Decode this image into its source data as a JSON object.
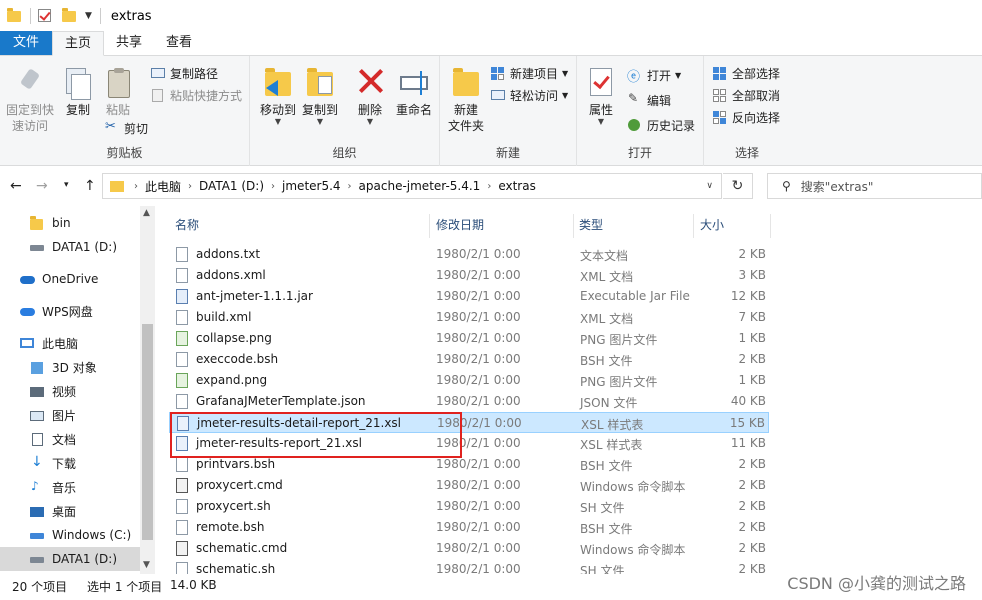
{
  "window": {
    "title": "extras"
  },
  "ribbon_tabs": [
    "文件",
    "主页",
    "共享",
    "查看"
  ],
  "ribbon": {
    "clipboard": {
      "label": "剪贴板",
      "pin": "固定到快速访问",
      "pin_line1": "固定到快",
      "pin_line2": "速访问",
      "copy": "复制",
      "paste": "粘贴",
      "copy_path": "复制路径",
      "paste_shortcut": "粘贴快捷方式",
      "cut": "剪切"
    },
    "organize": {
      "label": "组织",
      "move_to": "移动到",
      "copy_to": "复制到",
      "delete": "删除",
      "rename": "重命名"
    },
    "new": {
      "label": "新建",
      "new_folder_line1": "新建",
      "new_folder_line2": "文件夹",
      "new_item": "新建项目",
      "easy_access": "轻松访问"
    },
    "open": {
      "label": "打开",
      "properties": "属性",
      "open": "打开",
      "edit": "编辑",
      "history": "历史记录"
    },
    "select": {
      "label": "选择",
      "select_all": "全部选择",
      "select_none": "全部取消",
      "invert": "反向选择"
    }
  },
  "address": {
    "crumbs": [
      "此电脑",
      "DATA1 (D:)",
      "jmeter5.4",
      "apache-jmeter-5.4.1",
      "extras"
    ],
    "search_placeholder": "搜索\"extras\""
  },
  "nav_pane": {
    "items": [
      {
        "label": "bin",
        "icon": "folder-icon"
      },
      {
        "label": "DATA1 (D:)",
        "icon": "drive-icon"
      },
      {
        "label": "OneDrive",
        "icon": "cloud-icon"
      },
      {
        "label": "WPS网盘",
        "icon": "cloud-icon"
      },
      {
        "label": "此电脑",
        "icon": "computer-icon"
      },
      {
        "label": "3D 对象",
        "icon": "cube-icon"
      },
      {
        "label": "视频",
        "icon": "video-icon"
      },
      {
        "label": "图片",
        "icon": "picture-icon"
      },
      {
        "label": "文档",
        "icon": "document-icon"
      },
      {
        "label": "下载",
        "icon": "download-icon"
      },
      {
        "label": "音乐",
        "icon": "music-icon"
      },
      {
        "label": "桌面",
        "icon": "desktop-icon"
      },
      {
        "label": "Windows (C:)",
        "icon": "drive-icon"
      },
      {
        "label": "DATA1 (D:)",
        "icon": "drive-icon"
      }
    ]
  },
  "columns": {
    "name": "名称",
    "date": "修改日期",
    "type": "类型",
    "size": "大小"
  },
  "files": [
    {
      "name": "addons.txt",
      "date": "1980/2/1 0:00",
      "type": "文本文档",
      "size": "2 KB",
      "icon": "txt"
    },
    {
      "name": "addons.xml",
      "date": "1980/2/1 0:00",
      "type": "XML 文档",
      "size": "3 KB",
      "icon": "txt"
    },
    {
      "name": "ant-jmeter-1.1.1.jar",
      "date": "1980/2/1 0:00",
      "type": "Executable Jar File",
      "size": "12 KB",
      "icon": "jar"
    },
    {
      "name": "build.xml",
      "date": "1980/2/1 0:00",
      "type": "XML 文档",
      "size": "7 KB",
      "icon": "txt"
    },
    {
      "name": "collapse.png",
      "date": "1980/2/1 0:00",
      "type": "PNG 图片文件",
      "size": "1 KB",
      "icon": "png"
    },
    {
      "name": "execcode.bsh",
      "date": "1980/2/1 0:00",
      "type": "BSH 文件",
      "size": "2 KB",
      "icon": "txt"
    },
    {
      "name": "expand.png",
      "date": "1980/2/1 0:00",
      "type": "PNG 图片文件",
      "size": "1 KB",
      "icon": "png"
    },
    {
      "name": "GrafanaJMeterTemplate.json",
      "date": "1980/2/1 0:00",
      "type": "JSON 文件",
      "size": "40 KB",
      "icon": "txt"
    },
    {
      "name": "jmeter-results-detail-report_21.xsl",
      "date": "1980/2/1 0:00",
      "type": "XSL 样式表",
      "size": "15 KB",
      "icon": "xsl",
      "selected": true
    },
    {
      "name": "jmeter-results-report_21.xsl",
      "date": "1980/2/1 0:00",
      "type": "XSL 样式表",
      "size": "11 KB",
      "icon": "xsl"
    },
    {
      "name": "printvars.bsh",
      "date": "1980/2/1 0:00",
      "type": "BSH 文件",
      "size": "2 KB",
      "icon": "txt"
    },
    {
      "name": "proxycert.cmd",
      "date": "1980/2/1 0:00",
      "type": "Windows 命令脚本",
      "size": "2 KB",
      "icon": "cmd"
    },
    {
      "name": "proxycert.sh",
      "date": "1980/2/1 0:00",
      "type": "SH 文件",
      "size": "2 KB",
      "icon": "txt"
    },
    {
      "name": "remote.bsh",
      "date": "1980/2/1 0:00",
      "type": "BSH 文件",
      "size": "2 KB",
      "icon": "txt"
    },
    {
      "name": "schematic.cmd",
      "date": "1980/2/1 0:00",
      "type": "Windows 命令脚本",
      "size": "2 KB",
      "icon": "cmd"
    },
    {
      "name": "schematic.sh",
      "date": "1980/2/1 0:00",
      "type": "SH 文件",
      "size": "2 KB",
      "icon": "txt"
    }
  ],
  "status": {
    "count": "20 个项目",
    "selected": "选中 1 个项目",
    "size": "14.0 KB"
  },
  "watermark": "CSDN @小龚的测试之路"
}
